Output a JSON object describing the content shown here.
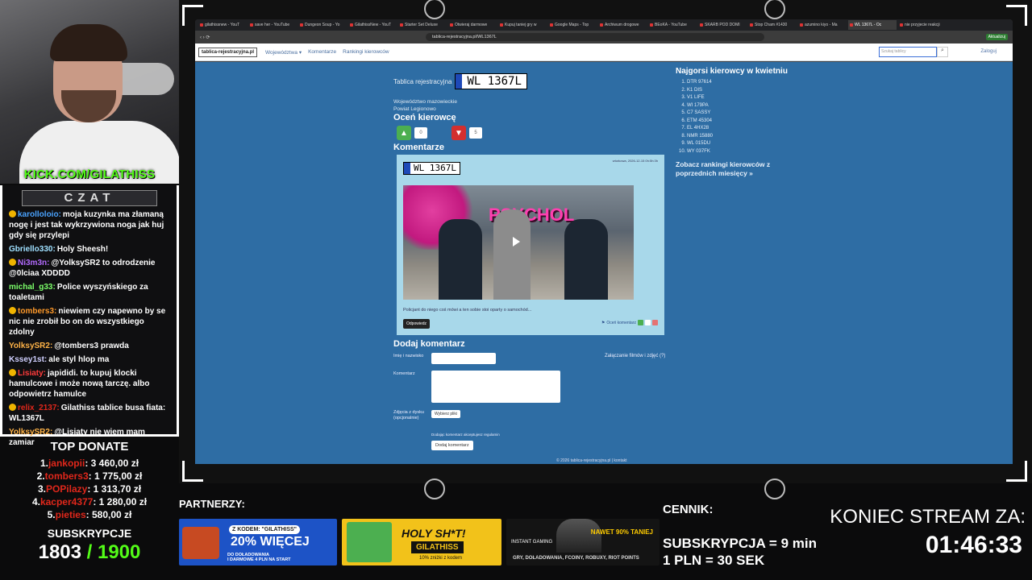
{
  "overlay": {
    "channel_banner": "KICK.COM/GILATHISS",
    "chat_title": "CZAT",
    "partners_label": "PARTNERZY:",
    "cennik_label": "CENNIK:",
    "price_sub": "SUBSKRYPCJA = 9 min",
    "price_pln": "1 PLN = 30 SEK",
    "countdown_label": "KONIEC STREAM ZA:",
    "countdown_value": "01:46:33"
  },
  "chat": [
    {
      "user": "karolloloio:",
      "text": "moja kuzynka ma złamaną nogę i jest tak wykrzywiona noga jak huj gdy się przylepi",
      "color": "#4aa3ff",
      "badge": true
    },
    {
      "user": "Gbriello330:",
      "text": "Holy Sheesh!",
      "color": "#9fe0ff",
      "badge": false
    },
    {
      "user": "Ni3m3n:",
      "text": "@YolksySR2 to odrodzenie @0lciaa XDDDD",
      "color": "#b36bff",
      "badge": true
    },
    {
      "user": "michal_g33:",
      "text": "Police wyszyńskiego za toaletami",
      "color": "#7cff6a",
      "badge": false
    },
    {
      "user": "tombers3:",
      "text": "niewiem czy napewno by se nic nie zrobił bo on do wszystkiego zdolny",
      "color": "#ff9a2a",
      "badge": true
    },
    {
      "user": "YolksySR2:",
      "text": "@tombers3 prawda",
      "color": "#ffb347",
      "badge": false
    },
    {
      "user": "Kssey1st:",
      "text": "ale styl hlop ma",
      "color": "#d0d0ff",
      "badge": false
    },
    {
      "user": "Lisiaty:",
      "text": "japididi. to kupuj klocki hamulcowe i może nową tarczę. albo odpowietrz hamulce",
      "color": "#ff3b3b",
      "badge": true
    },
    {
      "user": "relix_2137:",
      "text": "Gilathiss tablice busa fiata: WL1367L",
      "color": "#e0271b",
      "badge": true
    },
    {
      "user": "YolksySR2:",
      "text": "@Lisiaty nie wiem mam zamiar",
      "color": "#ffb347",
      "badge": false
    }
  ],
  "top_donate": {
    "title": "TOP DONATE",
    "entries": [
      {
        "rank": "1.",
        "name": "jankopii",
        "amount": ": 3 460,00 zł"
      },
      {
        "rank": "2.",
        "name": "tombers3",
        "amount": ": 1 775,00 zł"
      },
      {
        "rank": "3.",
        "name": "POPilazy",
        "amount": ": 1 313,70 zł"
      },
      {
        "rank": "4.",
        "name": "kacper4377",
        "amount": ": 1 280,00 zł"
      },
      {
        "rank": "5.",
        "name": "pieties",
        "amount": ": 580,00 zł"
      }
    ]
  },
  "subs": {
    "label": "SUBSKRYPCJE",
    "current": "1803",
    "goal": " / 1900"
  },
  "browser": {
    "tabs": [
      "gilathissnew - YouT",
      "save her - YouTube",
      "Dungeon Soup - Yo",
      "GilathissNew - YouT",
      "Starter Set Deluxe",
      "Otwieraj darmowe",
      "Kupuj taniej gry w",
      "Google Maps - Top",
      "Archiwum drogowe",
      "BEoKA - YouTube",
      "SKARB POD DOMI",
      "Stop Cham #1430",
      "azumino kiyo - Ma",
      "WL 1367L - Oc",
      "nie przyjecie reakcji"
    ],
    "active_tab": 13,
    "address": "tablica-rejestracyjna.pl/WL1367L",
    "account_label": "Aktualizuj"
  },
  "site": {
    "brand": "tablica-rejestracyjna.pl",
    "nav": [
      "Województwa ▾",
      "Komentarze",
      "Rankingi kierowców"
    ],
    "search_placeholder": "Szukaj tablicy",
    "login": "Zaloguj",
    "plate_label": "Tablica rejestracyjna",
    "plate": "WL 1367L",
    "voivodeship": "Województwo mazowieckie",
    "county": "Powiat Legionowo",
    "rate_heading": "Oceń kierowcę",
    "likes": "0",
    "dislikes": "5",
    "comments_heading": "Komentarze",
    "comment": {
      "date": "wtorkowa, 2026-12-15 0h:5h:3h",
      "plate": "WL 1367L",
      "video_title": "PSYCHOL",
      "text": "Policjant do niego coś mówi a ten sobie stoi oparty o samochód...",
      "reply": "Odpowiedz",
      "rate": "Oceń komentarz"
    },
    "add_heading": "Dodaj komentarz",
    "form": {
      "name_label": "Imię i nazwisko",
      "comment_label": "Komentarz",
      "photos_label": "Zdjęcia z dysku (opcjonalnie)",
      "choose_files": "Wybierz pliki",
      "accept": "Dodając komentarz akceptujesz regulamin",
      "submit": "Dodaj komentarz",
      "attach_help": "Załączanie filmów i zdjęć (?)"
    },
    "footer": "© 2026 tablica-rejestracyjna.pl | kontakt",
    "sidebar": {
      "title": "Najgorsi kierowcy w kwietniu",
      "list": [
        "DTR 97614",
        "K1 DIS",
        "V1 LIFE",
        "WI 179PA",
        "C7 SASSY",
        "ETM 45304",
        "EL 4HX28",
        "NMR 15880",
        "WL 015DU",
        "WY 037FK"
      ],
      "more": "Zobacz rankingi kierowców z poprzednich miesięcy »"
    }
  },
  "ads": {
    "ad1": {
      "code": "Z KODEM: \"GILATHISS\"",
      "big": "20% WIĘCEJ",
      "line2": "DO DOŁADOWANIA",
      "small": "I DARMOWE 4 PLN NA START"
    },
    "ad2": {
      "big": "HOLY SH*T!",
      "mid": "GILATHISS",
      "small": "10% zniżki z kodem"
    },
    "ad3": {
      "brand": "INSTANT GAMING",
      "badge": "NAWET 90% TANIEJ",
      "small": "GRY, DOŁADOWANIA, FCOINY, ROBUXY, RIOT POINTS"
    }
  }
}
